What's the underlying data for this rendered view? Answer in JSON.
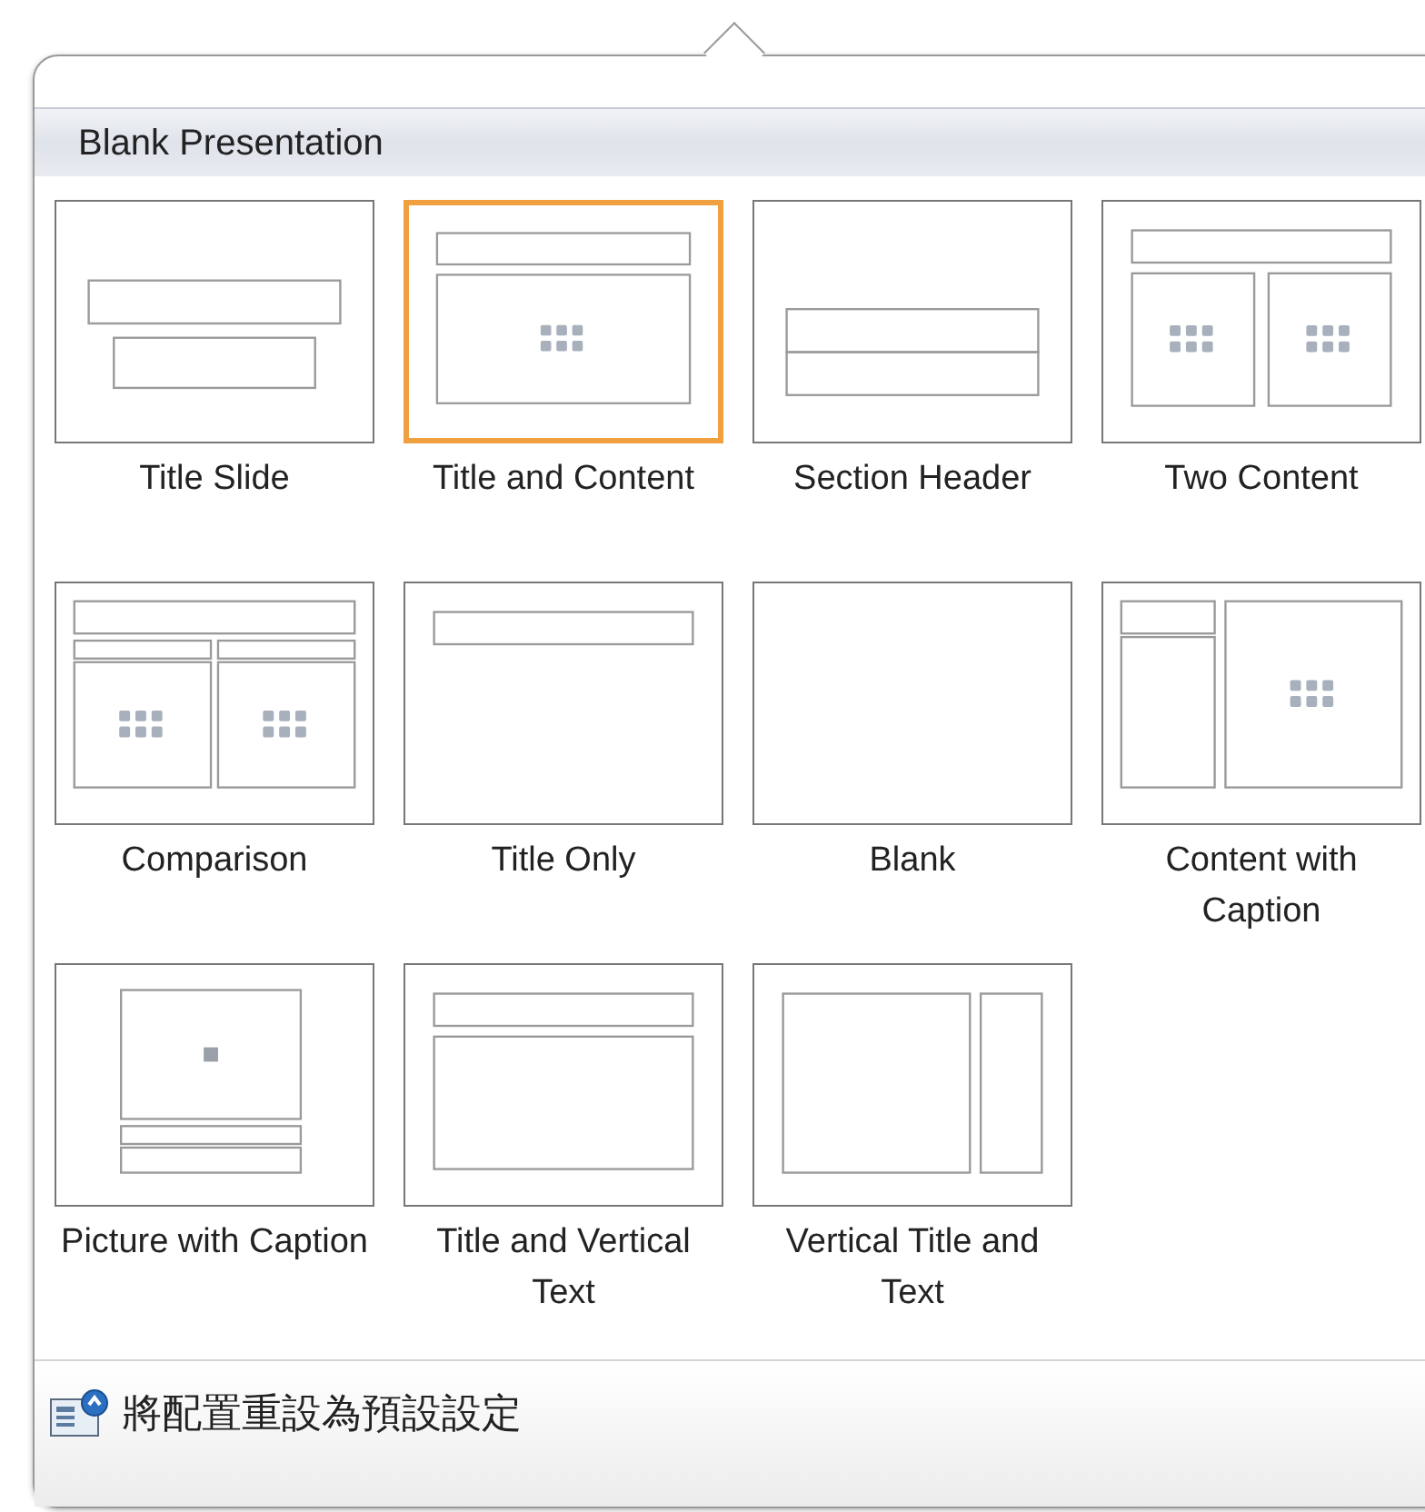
{
  "header": {
    "title": "Blank Presentation"
  },
  "layouts": [
    {
      "label": "Title Slide",
      "kind": "title_slide",
      "selected": false
    },
    {
      "label": "Title and Content",
      "kind": "title_content",
      "selected": true
    },
    {
      "label": "Section Header",
      "kind": "section_header",
      "selected": false
    },
    {
      "label": "Two Content",
      "kind": "two_content",
      "selected": false
    },
    {
      "label": "Comparison",
      "kind": "comparison",
      "selected": false
    },
    {
      "label": "Title Only",
      "kind": "title_only",
      "selected": false
    },
    {
      "label": "Blank",
      "kind": "blank",
      "selected": false
    },
    {
      "label": "Content with Caption",
      "kind": "content_caption",
      "selected": false
    },
    {
      "label": "Picture with Caption",
      "kind": "picture_caption",
      "selected": false
    },
    {
      "label": "Title and Vertical Text",
      "kind": "title_vertical",
      "selected": false
    },
    {
      "label": "Vertical Title and Text",
      "kind": "vertical_title",
      "selected": false
    }
  ],
  "footer": {
    "label": "將配置重設為預設設定"
  }
}
